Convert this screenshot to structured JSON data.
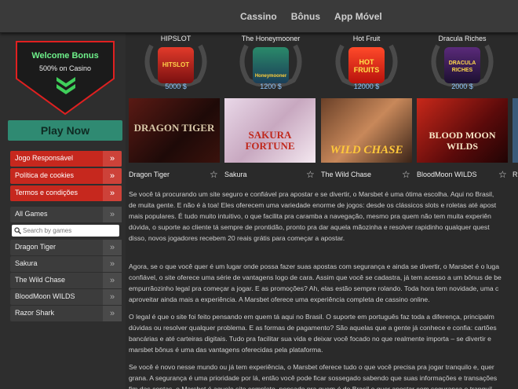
{
  "topnav": [
    "Cassino",
    "Bônus",
    "App Móvel"
  ],
  "sidebar": {
    "bonus_title": "Welcome Bonus",
    "bonus_sub": "500% on Casino",
    "play_label": "Play Now",
    "red_links": [
      "Jogo Responsável",
      "Política de cookies",
      "Termos e condições"
    ],
    "all_games": "All Games",
    "search_placeholder": "Search by games",
    "games": [
      "Dragon Tiger",
      "Sakura",
      "The Wild Chase",
      "BloodMoon WILDS",
      "Razor Shark"
    ]
  },
  "jackpots": [
    {
      "name": "HIPSLOT",
      "amount": "5000 $",
      "logo": "HITSLOT"
    },
    {
      "name": "The Honeymooner",
      "amount": "1200 $",
      "logo": "Honeymooner"
    },
    {
      "name": "Hot Fruit",
      "amount": "12000 $",
      "logo": "HOT FRUITS"
    },
    {
      "name": "Dracula Riches",
      "amount": "2000 $",
      "logo": "DRACULA RICHES"
    }
  ],
  "cards": [
    {
      "label": "Dragon Tiger",
      "logo": "DRAGON TIGER"
    },
    {
      "label": "Sakura",
      "logo": "SAKURA FORTUNE"
    },
    {
      "label": "The Wild Chase",
      "logo": "WILD CHASE"
    },
    {
      "label": "BloodMoon WILDS",
      "logo": "BLOOD MOON WILDS"
    },
    {
      "label": "R",
      "logo": ""
    }
  ],
  "paragraphs": [
    "Se você tá procurando um site seguro e confiável pra apostar e se divertir, o Marsbet é uma ótima escolha. Aqui no Brasil,\nde muita gente. E não é à toa! Eles oferecem uma variedade enorme de jogos: desde os clássicos slots e roletas até apost\nmais populares. É tudo muito intuitivo, o que facilita pra caramba a navegação, mesmo pra quem não tem muita experiên\ndúvida, o suporte ao cliente tá sempre de prontidão, pronto pra dar aquela mãozinha e resolver rapidinho qualquer quest\ndisso, novos jogadores recebem 20 reais grátis para começar a apostar.",
    "Agora, se o que você quer é um lugar onde possa fazer suas apostas com segurança e ainda se divertir, o Marsbet é o luga\nconfiável, o site oferece uma série de vantagens logo de cara. Assim que você se cadastra, já tem acesso a um bônus de be\nempurrãozinho legal pra começar a jogar. E as promoções? Ah, elas estão sempre rolando. Toda hora tem novidade, uma c\naproveitar ainda mais a experiência. A Marsbet oferece uma experiência completa de cassino online.",
    "O legal é que o site foi feito pensando em quem tá aqui no Brasil. O suporte em português faz toda a diferença, principalm\ndúvidas ou resolver qualquer problema. E as formas de pagamento? São aquelas que a gente já conhece e confia: cartões\nbancárias e até carteiras digitais. Tudo pra facilitar sua vida e deixar você focado no que realmente importa – se divertir e\nmarsbet bônus é uma das vantagens oferecidas pela plataforma.",
    "Se você é novo nesse mundo ou já tem experiência, o Marsbet oferece tudo o que você precisa pra jogar tranquilo e, quer\ngrana. A segurança é uma prioridade por lá, então você pode ficar sossegado sabendo que suas informações e transações\nfim das contas, o Marsbet é aquele site completo, pensado pra quem é do Brasil e quer apostar com segurança e tranquil"
  ]
}
